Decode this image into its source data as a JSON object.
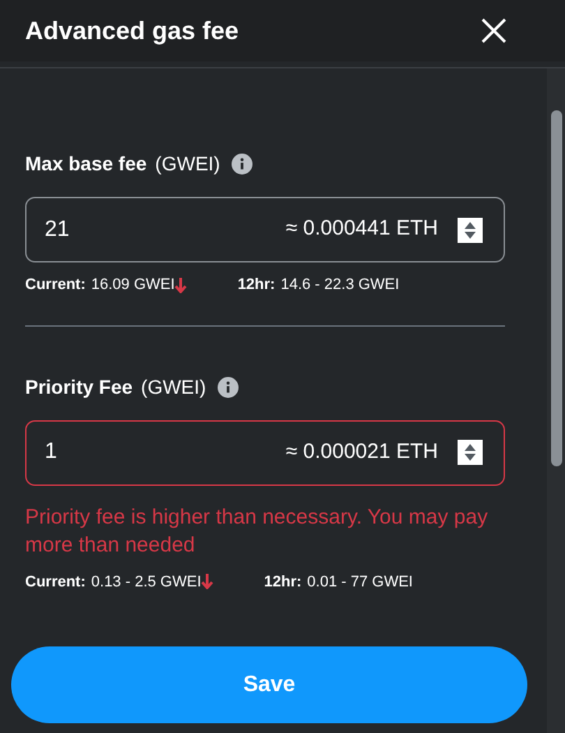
{
  "window": {
    "title": "Advanced gas fee"
  },
  "fields": [
    {
      "label": "Max base fee",
      "unit": "(GWEI)",
      "value": "21",
      "conversion": "≈ 0.000441 ETH",
      "error": false,
      "stats": [
        {
          "label": "Current:",
          "value": "16.09 GWEI",
          "falling": true
        },
        {
          "label": "12hr:",
          "value": "14.6 - 22.3 GWEI"
        }
      ]
    },
    {
      "label": "Priority Fee",
      "unit": "(GWEI)",
      "value": "1",
      "conversion": "≈ 0.000021 ETH",
      "error": true,
      "message": "Priority fee is higher than necessary. You may pay more than needed",
      "stats": [
        {
          "label": "Current:",
          "value": "0.13 - 2.5 GWEI",
          "falling": true
        },
        {
          "label": "12hr:",
          "value": "0.01 - 77 GWEI"
        }
      ]
    }
  ],
  "save_button": "Save"
}
